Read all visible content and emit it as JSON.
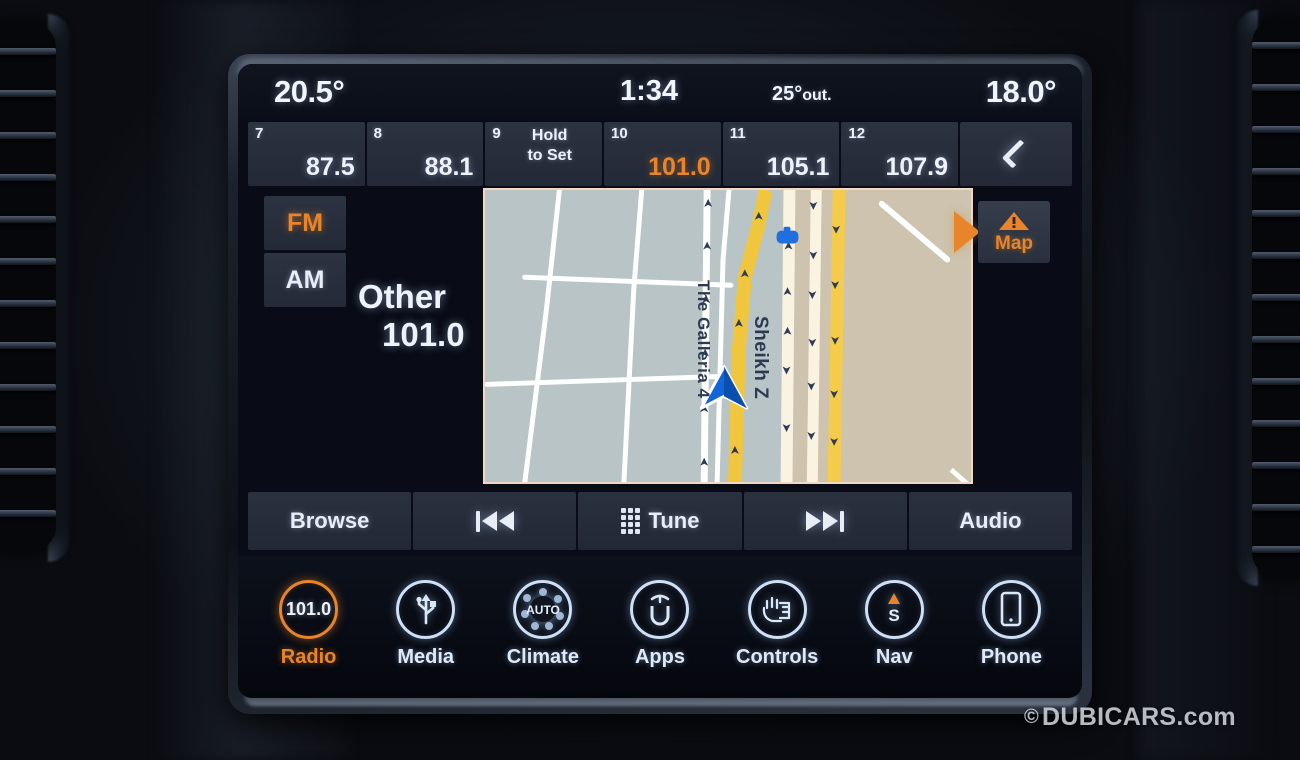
{
  "status_bar": {
    "temp_left": "20.5°",
    "clock": "1:34",
    "outside_label": "25°",
    "outside_suffix": "out.",
    "temp_right": "18.0°"
  },
  "presets": {
    "items": [
      {
        "num": "7",
        "freq": "87.5",
        "active": false
      },
      {
        "num": "8",
        "freq": "88.1",
        "active": false
      },
      {
        "num": "9",
        "hold_line1": "Hold",
        "hold_line2": "to Set",
        "active": false
      },
      {
        "num": "10",
        "freq": "101.0",
        "active": true
      },
      {
        "num": "11",
        "freq": "105.1",
        "active": false
      },
      {
        "num": "12",
        "freq": "107.9",
        "active": false
      }
    ],
    "back_label": "back-chevron"
  },
  "bands": {
    "fm_label": "FM",
    "am_label": "AM",
    "active": "FM"
  },
  "station": {
    "name": "Other",
    "frequency": "101.0"
  },
  "map_widget": {
    "button_label": "Map",
    "street_primary": "The Galleria 4",
    "street_secondary": "Sheikh Z",
    "colors": {
      "land_left": "#b9c4c6",
      "land_right": "#cdc3ae",
      "highway": "#f5c843",
      "road_white": "#ffffff",
      "marker_blue": "#1f6fe0",
      "accent": "#e8842a"
    }
  },
  "transport": {
    "browse_label": "Browse",
    "prev_label": "seek-previous",
    "tune_label": "Tune",
    "next_label": "seek-next",
    "audio_label": "Audio"
  },
  "navbar": {
    "items": [
      {
        "label": "Radio",
        "icon": "radio-frequency-icon",
        "badge": "101.0",
        "active": true
      },
      {
        "label": "Media",
        "icon": "usb-icon",
        "active": false
      },
      {
        "label": "Climate",
        "icon": "auto-climate-icon",
        "badge": "AUTO",
        "active": false
      },
      {
        "label": "Apps",
        "icon": "uconnect-icon",
        "active": false
      },
      {
        "label": "Controls",
        "icon": "hand-controls-icon",
        "active": false
      },
      {
        "label": "Nav",
        "icon": "compass-south-icon",
        "badge": "S",
        "active": false
      },
      {
        "label": "Phone",
        "icon": "phone-icon",
        "active": false
      }
    ]
  },
  "watermark": {
    "copyright": "©",
    "text": "DUBICARS.com"
  }
}
